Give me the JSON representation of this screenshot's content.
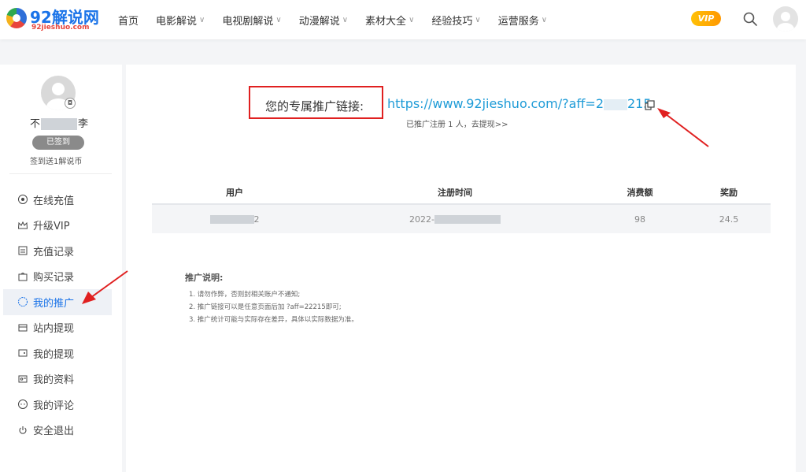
{
  "brand": {
    "title": "92解说网",
    "subtitle": "92jieshuo.com"
  },
  "nav": {
    "items": [
      {
        "label": "首页",
        "dropdown": false
      },
      {
        "label": "电影解说",
        "dropdown": true
      },
      {
        "label": "电视剧解说",
        "dropdown": true
      },
      {
        "label": "动漫解说",
        "dropdown": true
      },
      {
        "label": "素材大全",
        "dropdown": true
      },
      {
        "label": "经验技巧",
        "dropdown": true
      },
      {
        "label": "运营服务",
        "dropdown": true
      }
    ],
    "vip_label": "VIP"
  },
  "sidebar": {
    "username_left": "不",
    "username_right": "李",
    "checked_label": "已签到",
    "signin_tip": "签到送1解说币",
    "menu": [
      {
        "label": "在线充值",
        "icon": "coin-icon",
        "active": false
      },
      {
        "label": "升级VIP",
        "icon": "crown-icon",
        "active": false
      },
      {
        "label": "充值记录",
        "icon": "record-icon",
        "active": false
      },
      {
        "label": "购买记录",
        "icon": "bag-icon",
        "active": false
      },
      {
        "label": "我的推广",
        "icon": "promote-icon",
        "active": true
      },
      {
        "label": "站内提现",
        "icon": "withdraw-icon",
        "active": false
      },
      {
        "label": "我的提现",
        "icon": "wallet-icon",
        "active": false
      },
      {
        "label": "我的资料",
        "icon": "profile-icon",
        "active": false
      },
      {
        "label": "我的评论",
        "icon": "comment-icon",
        "active": false
      },
      {
        "label": "安全退出",
        "icon": "power-icon",
        "active": false
      }
    ]
  },
  "referral": {
    "label": "您的专属推广链接:",
    "link_prefix": "https://www.92jieshuo.com/?aff=2",
    "link_suffix": "215",
    "summary": "已推广注册 1 人，去提现>>"
  },
  "table": {
    "headers": [
      "用户",
      "注册时间",
      "消费额",
      "奖励"
    ],
    "rows": [
      {
        "user_suffix": "2",
        "time_prefix": "2022-",
        "amount": "98",
        "reward": "24.5"
      }
    ]
  },
  "notes": {
    "title": "推广说明:",
    "items": [
      "1. 请勿作弊，否则封相关账户不通知;",
      "2. 推广链接可以是任意页面后加 ?aff=22215即可;",
      "3. 推广统计可能与实际存在差异，具体以实际数据为准。"
    ]
  },
  "colors": {
    "accent": "#1a73e8",
    "link": "#1e9bd7",
    "annotation_red": "#e02020",
    "vip_gold": "#ffb300"
  }
}
